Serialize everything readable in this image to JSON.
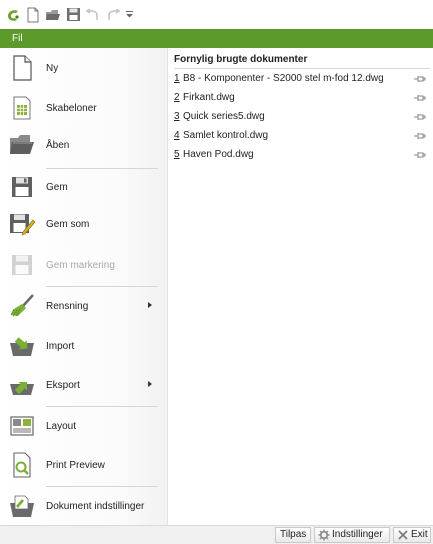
{
  "qat": {
    "icons": [
      "app-logo-icon",
      "new-file-icon",
      "open-folder-icon",
      "save-icon",
      "undo-icon",
      "redo-icon",
      "qat-dropdown-icon"
    ]
  },
  "ribbon": {
    "file_tab": "Fil"
  },
  "menu": {
    "items": [
      {
        "id": "ny",
        "label": "Ny",
        "icon": "new-document-icon",
        "enabled": true,
        "submenu": false
      },
      {
        "id": "skabeloner",
        "label": "Skabeloner",
        "icon": "templates-icon",
        "enabled": true,
        "submenu": false
      },
      {
        "id": "aben",
        "label": "Åben",
        "icon": "open-folder-icon",
        "enabled": true,
        "submenu": false
      },
      {
        "id": "gem",
        "label": "Gem",
        "icon": "save-icon",
        "enabled": true,
        "submenu": false
      },
      {
        "id": "gem-som",
        "label": "Gem som",
        "icon": "save-as-icon",
        "enabled": true,
        "submenu": false
      },
      {
        "id": "gem-markering",
        "label": "Gem markering",
        "icon": "save-selection-icon",
        "enabled": false,
        "submenu": false
      },
      {
        "id": "rensning",
        "label": "Rensning",
        "icon": "broom-icon",
        "enabled": true,
        "submenu": true
      },
      {
        "id": "import",
        "label": "Import",
        "icon": "import-icon",
        "enabled": true,
        "submenu": false
      },
      {
        "id": "eksport",
        "label": "Eksport",
        "icon": "export-icon",
        "enabled": true,
        "submenu": true
      },
      {
        "id": "layout",
        "label": "Layout",
        "icon": "layout-icon",
        "enabled": true,
        "submenu": false
      },
      {
        "id": "print-preview",
        "label": "Print Preview",
        "icon": "print-preview-icon",
        "enabled": true,
        "submenu": false
      },
      {
        "id": "dokument-indstillinger",
        "label": "Dokument indstillinger",
        "icon": "document-settings-icon",
        "enabled": true,
        "submenu": false
      }
    ]
  },
  "recent": {
    "title": "Fornylig brugte dokumenter",
    "documents": [
      {
        "num": "1",
        "name": "B8 - Komponenter - S2000 stel m-fod 12.dwg"
      },
      {
        "num": "2",
        "name": "Firkant.dwg"
      },
      {
        "num": "3",
        "name": "Quick series5.dwg"
      },
      {
        "num": "4",
        "name": "Samlet kontrol.dwg"
      },
      {
        "num": "5",
        "name": "Haven Pod.dwg"
      }
    ]
  },
  "bottom": {
    "tilpas": "Tilpas",
    "indstillinger": "Indstillinger",
    "exit": "Exit"
  },
  "colors": {
    "accent_green": "#5c9b2a"
  }
}
